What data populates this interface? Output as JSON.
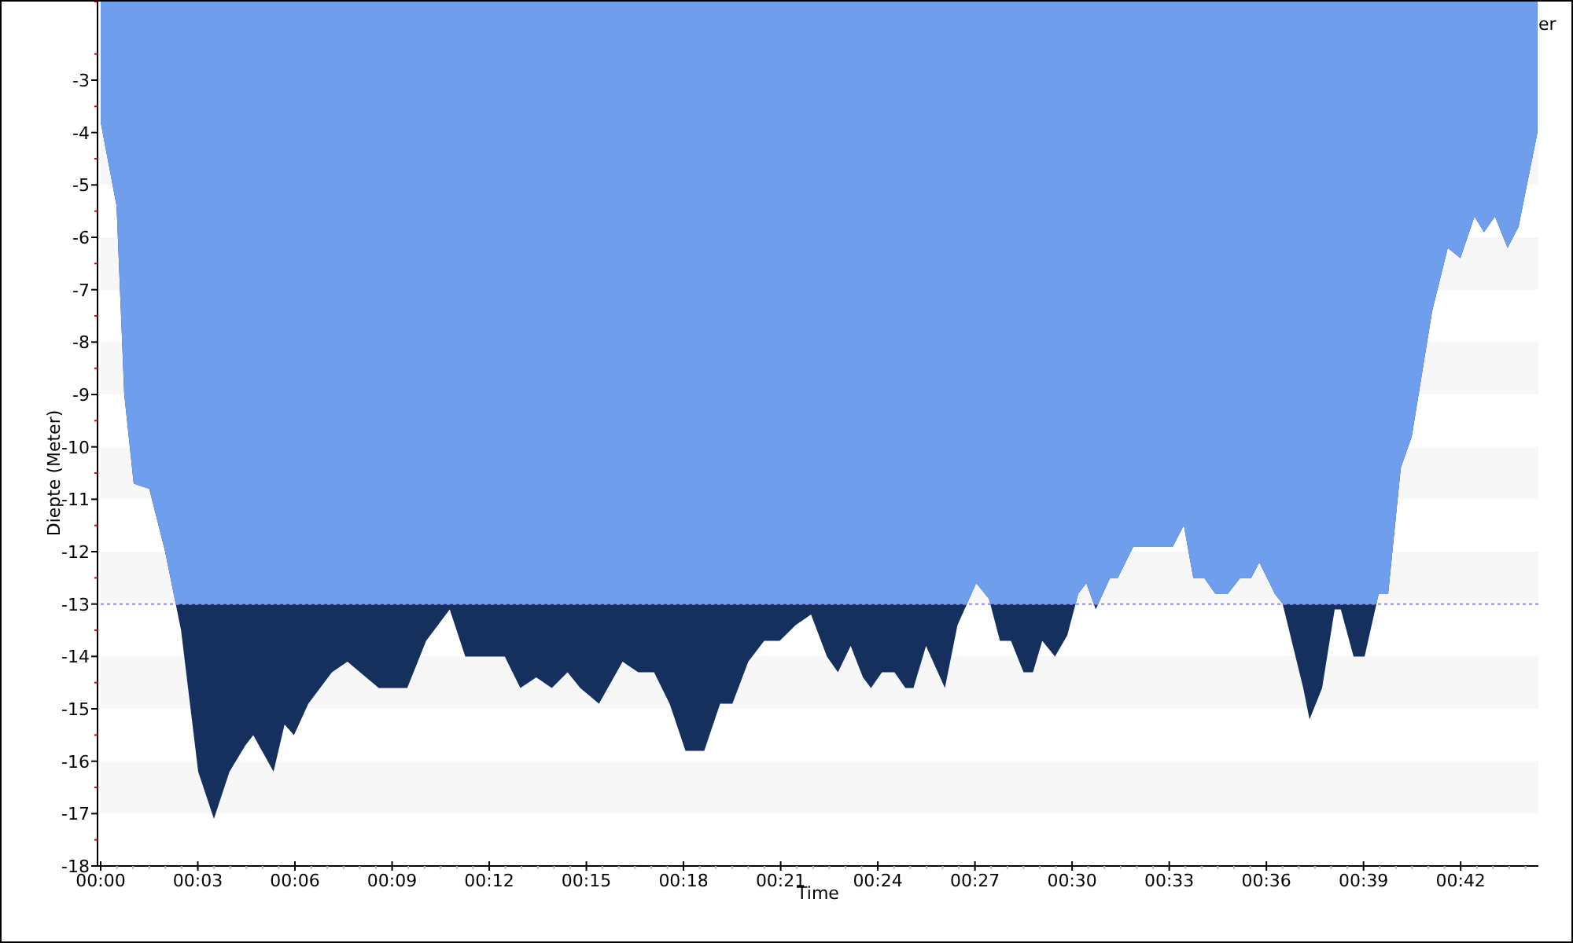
{
  "legend": {
    "text": "er"
  },
  "chart_data": {
    "type": "area",
    "xlabel": "Time",
    "ylabel": "Diepte (Meter)",
    "xlim": [
      0,
      44.4
    ],
    "ylim": [
      -18,
      -1.5
    ],
    "xticks": [
      {
        "value": 0,
        "label": "00:00"
      },
      {
        "value": 3,
        "label": "00:03"
      },
      {
        "value": 6,
        "label": "00:06"
      },
      {
        "value": 9,
        "label": "00:09"
      },
      {
        "value": 12,
        "label": "00:12"
      },
      {
        "value": 15,
        "label": "00:15"
      },
      {
        "value": 18,
        "label": "00:18"
      },
      {
        "value": 21,
        "label": "00:21"
      },
      {
        "value": 24,
        "label": "00:24"
      },
      {
        "value": 27,
        "label": "00:27"
      },
      {
        "value": 30,
        "label": "00:30"
      },
      {
        "value": 33,
        "label": "00:33"
      },
      {
        "value": 36,
        "label": "00:36"
      },
      {
        "value": 39,
        "label": "00:39"
      },
      {
        "value": 42,
        "label": "00:42"
      }
    ],
    "yticks": [
      -3,
      -4,
      -5,
      -6,
      -7,
      -8,
      -9,
      -10,
      -11,
      -12,
      -13,
      -14,
      -15,
      -16,
      -17,
      -18
    ],
    "x": [
      0,
      0.49,
      0.73,
      1.02,
      1.5,
      1.99,
      2.48,
      3.01,
      3.5,
      3.98,
      4.47,
      4.71,
      5.34,
      5.68,
      5.97,
      6.41,
      7.14,
      7.62,
      8.01,
      8.59,
      9.47,
      10.05,
      10.78,
      11.26,
      12.48,
      12.96,
      13.45,
      13.93,
      14.42,
      14.81,
      15.39,
      16.12,
      16.6,
      17.09,
      17.57,
      18.06,
      18.64,
      19.13,
      19.51,
      20,
      20.49,
      20.97,
      21.46,
      21.94,
      22.43,
      22.77,
      23.16,
      23.54,
      23.79,
      24.13,
      24.51,
      24.85,
      25.1,
      25.49,
      26.07,
      26.46,
      27.04,
      27.43,
      27.77,
      28.11,
      28.5,
      28.79,
      29.08,
      29.47,
      29.85,
      30.19,
      30.44,
      30.73,
      31.17,
      31.41,
      31.89,
      33.11,
      33.45,
      33.74,
      34.08,
      34.42,
      34.81,
      35.19,
      35.53,
      35.78,
      36.26,
      36.5,
      37.14,
      37.33,
      37.72,
      38.11,
      38.3,
      38.69,
      39.03,
      39.47,
      39.76,
      40.15,
      40.49,
      41.12,
      41.6,
      41.99,
      42.43,
      42.72,
      43.06,
      43.45,
      43.79,
      44.37
    ],
    "series": [
      {
        "color": "#6f9fec",
        "values": [
          -3.8,
          -5.4,
          -9,
          -10.7,
          -10.8,
          -12,
          -13.5,
          -16.2,
          -17.1,
          -16.2,
          -15.7,
          -15.5,
          -16.2,
          -15.3,
          -15.5,
          -14.9,
          -14.3,
          -14.1,
          -14.3,
          -14.6,
          -14.6,
          -13.7,
          -13.1,
          -14,
          -14,
          -14.6,
          -14.4,
          -14.6,
          -14.3,
          -14.6,
          -14.9,
          -14.1,
          -14.3,
          -14.3,
          -14.9,
          -15.8,
          -15.8,
          -14.9,
          -14.9,
          -14.1,
          -13.7,
          -13.7,
          -13.4,
          -13.2,
          -14,
          -14.3,
          -13.8,
          -14.4,
          -14.6,
          -14.3,
          -14.3,
          -14.6,
          -14.6,
          -13.8,
          -14.6,
          -13.4,
          -12.6,
          -12.9,
          -13.7,
          -13.7,
          -14.3,
          -14.3,
          -13.7,
          -14,
          -13.6,
          -12.8,
          -12.6,
          -13.1,
          -12.5,
          -12.5,
          -11.9,
          -11.9,
          -11.5,
          -12.5,
          -12.5,
          -12.8,
          -12.8,
          -12.5,
          -12.5,
          -12.2,
          -12.8,
          -13,
          -14.6,
          -15.2,
          -14.6,
          -13.1,
          -13.1,
          -14,
          -14,
          -12.8,
          -12.8,
          -10.4,
          -9.8,
          -7.4,
          -6.2,
          -6.4,
          -5.6,
          -5.9,
          -5.6,
          -6.2,
          -5.8,
          -4
        ]
      }
    ],
    "ref_lines": [
      {
        "axis": "y",
        "value": -13,
        "color": "#8a8ae8"
      }
    ]
  }
}
